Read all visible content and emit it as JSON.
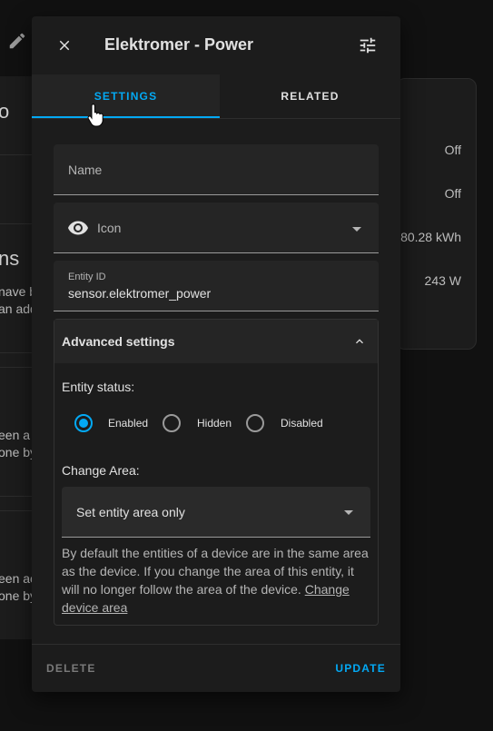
{
  "background": {
    "left_fragments": {
      "top_partial": "o",
      "heading_partial": "ns",
      "line_1": "nave b",
      "line_2": "an add",
      "line_3": "een a",
      "line_4": "one by",
      "line_5": "een ac",
      "line_6": "one by"
    },
    "right_values": [
      "Off",
      "Off",
      "80.28 kWh",
      "243 W"
    ]
  },
  "dialog": {
    "title": "Elektromer - Power",
    "tabs": [
      {
        "label": "SETTINGS",
        "active": true
      },
      {
        "label": "RELATED",
        "active": false
      }
    ],
    "fields": {
      "name_placeholder": "Name",
      "icon_placeholder": "Icon",
      "entity_id_label": "Entity ID",
      "entity_id_value": "sensor.elektromer_power"
    },
    "advanced": {
      "title": "Advanced settings",
      "entity_status_label": "Entity status:",
      "status_options": [
        {
          "label": "Enabled",
          "checked": true
        },
        {
          "label": "Hidden",
          "checked": false
        },
        {
          "label": "Disabled",
          "checked": false
        }
      ],
      "change_area_label": "Change Area:",
      "area_select_value": "Set entity area only",
      "description": "By default the entities of a device are in the same area as the device. If you change the area of this entity, it will no longer follow the area of the device.",
      "change_device_area_link": "Change device area"
    },
    "footer": {
      "delete_label": "DELETE",
      "update_label": "UPDATE"
    }
  },
  "colors": {
    "accent": "#03a9f4",
    "dialog_bg": "#1c1c1c",
    "page_bg": "#111111",
    "field_bg": "#252525"
  },
  "icons": {
    "header_left": "pencil-icon",
    "close": "close-icon",
    "settings": "tune-icon",
    "entity_icon": "eye-icon",
    "collapse": "chevron-up-icon",
    "cursor": "hand-pointer-icon"
  }
}
